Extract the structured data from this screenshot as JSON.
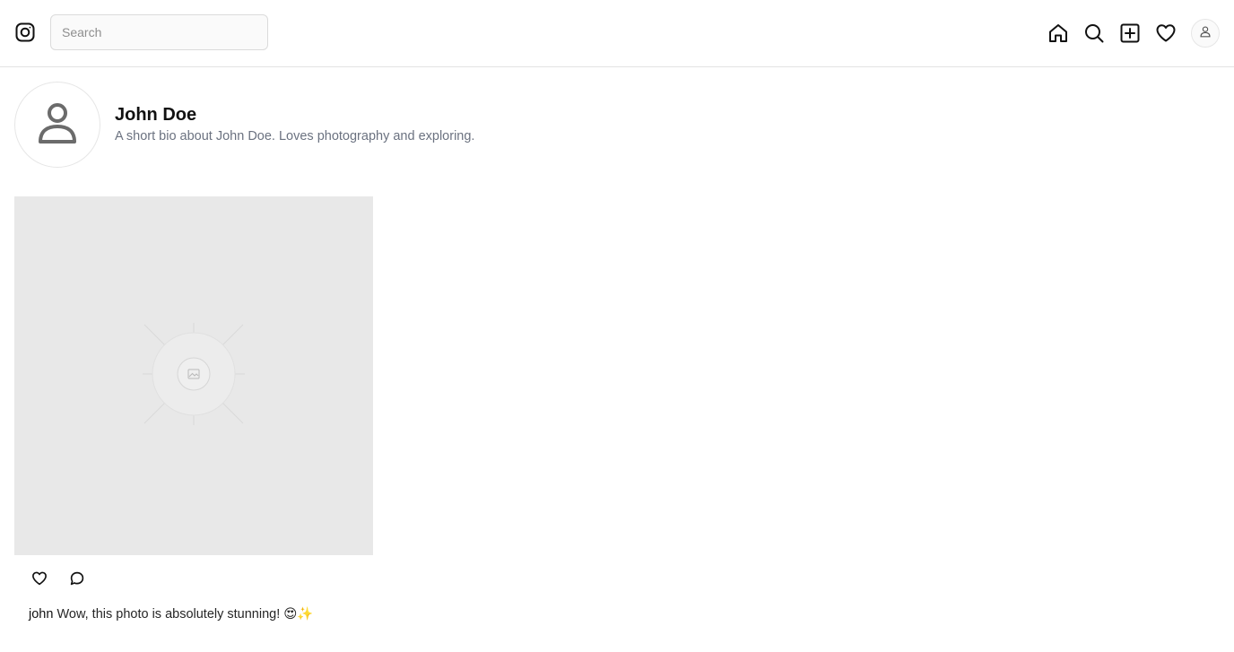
{
  "header": {
    "logo_icon": "instagram-logo-icon",
    "search": {
      "placeholder": "Search",
      "value": ""
    },
    "nav": [
      {
        "name": "home",
        "icon": "home-icon"
      },
      {
        "name": "explore",
        "icon": "search-icon"
      },
      {
        "name": "create",
        "icon": "plus-square-icon"
      },
      {
        "name": "notifications",
        "icon": "heart-icon"
      },
      {
        "name": "profile",
        "icon": "user-avatar-icon"
      }
    ]
  },
  "profile": {
    "name": "John Doe",
    "bio": "A short bio about John Doe. Loves photography and exploring.",
    "avatar_icon": "user-placeholder-icon"
  },
  "post": {
    "image_icon": "image-placeholder-icon",
    "actions": [
      {
        "name": "like",
        "icon": "heart-icon"
      },
      {
        "name": "comment",
        "icon": "comment-bubble-icon"
      }
    ],
    "comment": {
      "user": "john",
      "text": "Wow, this photo is absolutely stunning! 😍✨"
    }
  },
  "colors": {
    "border": "#e3e3e3",
    "placeholder_bg": "#e8e8e8",
    "bio_text": "#6b7280",
    "icon": "#111111"
  }
}
